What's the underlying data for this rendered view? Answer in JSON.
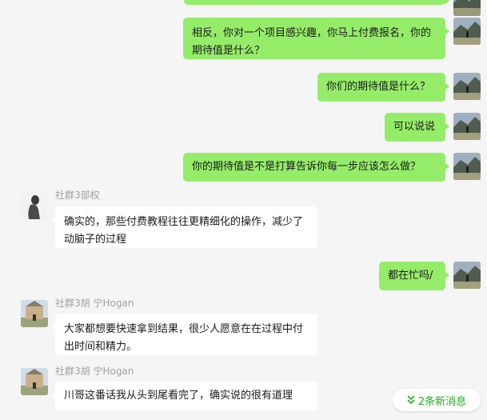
{
  "messages": [
    {
      "text": "相反，你对一个项目感兴趣，你马上付费报名，你的期待值是什么？"
    },
    {
      "text": "你们的期待值是什么？"
    },
    {
      "text": "可以说说"
    },
    {
      "text": "你的期待值是不是打算告诉你每一步应该怎么做？"
    },
    {
      "sender": "社群3部权",
      "text": "确实的，那些付费教程往往更精细化的操作，减少了动脑子的过程"
    },
    {
      "text": "都在忙吗/"
    },
    {
      "sender": "社群3胡 宁Hogan",
      "text": "大家都想要快速拿到结果，很少人愿意在在过程中付出时间和精力。"
    },
    {
      "sender": "社群3胡 宁Hogan",
      "text": "川哥这番话我从头到尾看完了，确实说的很有道理"
    }
  ],
  "new_messages": {
    "label": "2条新消息",
    "icon": "double-chevron-down-icon"
  },
  "colors": {
    "my_bubble": "#95ec69",
    "other_bubble": "#ffffff",
    "accent": "#1aad19"
  }
}
